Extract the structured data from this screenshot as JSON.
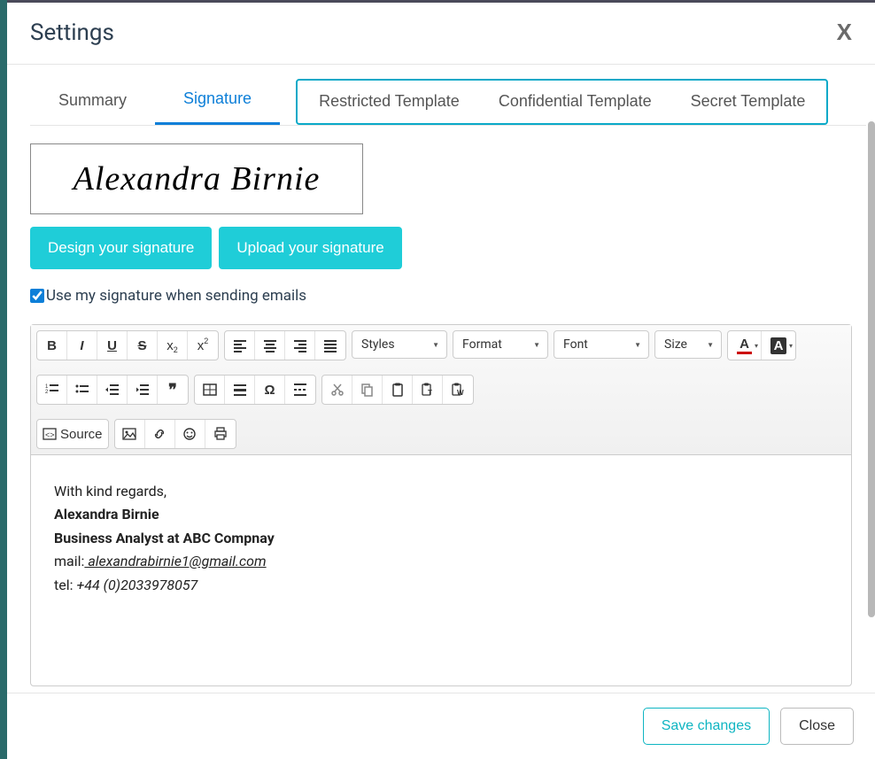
{
  "modal": {
    "title": "Settings",
    "close_x": "X"
  },
  "tabs": {
    "summary": "Summary",
    "signature": "Signature",
    "restricted": "Restricted Template",
    "confidential": "Confidential Template",
    "secret": "Secret Template"
  },
  "signature": {
    "preview_text": "Alexandra Birnie",
    "design_btn": "Design your signature",
    "upload_btn": "Upload your signature",
    "use_checkbox": "Use my signature when sending emails"
  },
  "toolbar": {
    "styles": "Styles",
    "format": "Format",
    "font": "Font",
    "size": "Size",
    "source": "Source"
  },
  "editor_content": {
    "greeting": "With kind regards,",
    "name": "Alexandra Birnie",
    "role": "Business Analyst at ABC Compnay",
    "mail_label": "mail:",
    "mail_value": " alexandrabirnie1@gmail.com",
    "tel_label": "tel: ",
    "tel_value": "+44 (0)2033978057"
  },
  "footer": {
    "save": "Save changes",
    "close": "Close"
  }
}
